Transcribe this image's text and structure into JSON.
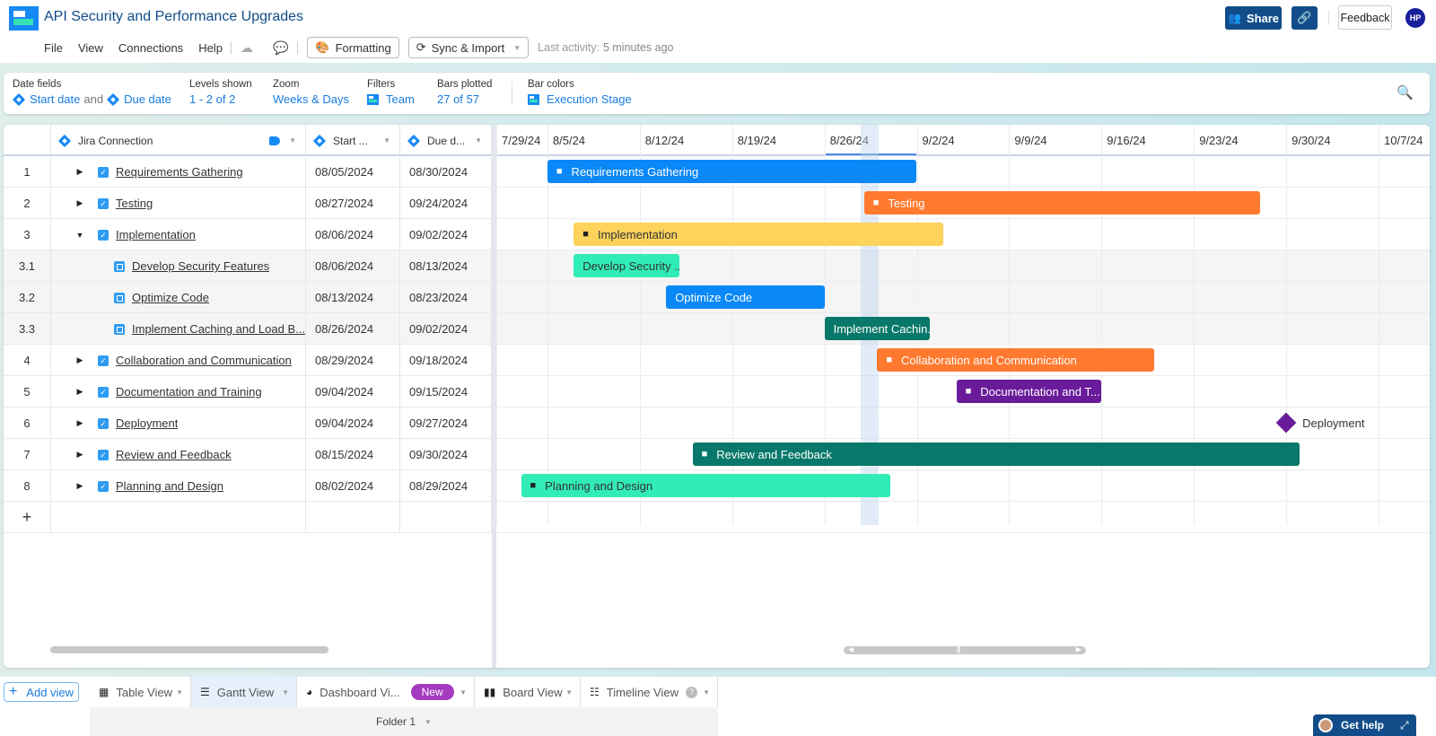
{
  "app": {
    "title": "API Security and Performance Upgrades",
    "menu": [
      "File",
      "View",
      "Connections",
      "Help"
    ],
    "formatting_label": "Formatting",
    "sync_label": "Sync & Import",
    "last_activity_label": "Last activity:",
    "last_activity_value": "5 minutes ago",
    "share_label": "Share",
    "feedback_label": "Feedback",
    "avatar_initials": "HP"
  },
  "settings": {
    "date_fields": {
      "label": "Date fields",
      "start": "Start date",
      "and": "and",
      "due": "Due date"
    },
    "levels": {
      "label": "Levels shown",
      "value": "1 - 2 of 2"
    },
    "zoom": {
      "label": "Zoom",
      "value": "Weeks & Days"
    },
    "filters": {
      "label": "Filters",
      "value": "Team"
    },
    "bars_plotted": {
      "label": "Bars plotted",
      "value": "27 of 57"
    },
    "bar_colors": {
      "label": "Bar colors",
      "value": "Execution Stage"
    }
  },
  "table": {
    "columns": {
      "name": "Jira Connection",
      "start": "Start ...",
      "due": "Due d..."
    },
    "rows": [
      {
        "num": "1",
        "name": "Requirements Gathering",
        "start": "08/05/2024",
        "due": "08/30/2024",
        "level": 1,
        "expanded": false
      },
      {
        "num": "2",
        "name": "Testing",
        "start": "08/27/2024",
        "due": "09/24/2024",
        "level": 1,
        "expanded": false
      },
      {
        "num": "3",
        "name": "Implementation",
        "start": "08/06/2024",
        "due": "09/02/2024",
        "level": 1,
        "expanded": true
      },
      {
        "num": "3.1",
        "name": "Develop Security Features",
        "start": "08/06/2024",
        "due": "08/13/2024",
        "level": 2
      },
      {
        "num": "3.2",
        "name": "Optimize Code",
        "start": "08/13/2024",
        "due": "08/23/2024",
        "level": 2
      },
      {
        "num": "3.3",
        "name": "Implement Caching and Load B...",
        "start": "08/26/2024",
        "due": "09/02/2024",
        "level": 2
      },
      {
        "num": "4",
        "name": "Collaboration and Communication",
        "start": "08/29/2024",
        "due": "09/18/2024",
        "level": 1,
        "expanded": false
      },
      {
        "num": "5",
        "name": "Documentation and Training",
        "start": "09/04/2024",
        "due": "09/15/2024",
        "level": 1,
        "expanded": false
      },
      {
        "num": "6",
        "name": "Deployment",
        "start": "09/04/2024",
        "due": "09/27/2024",
        "level": 1,
        "expanded": false
      },
      {
        "num": "7",
        "name": "Review and Feedback",
        "start": "08/15/2024",
        "due": "09/30/2024",
        "level": 1,
        "expanded": false
      },
      {
        "num": "8",
        "name": "Planning and Design",
        "start": "08/02/2024",
        "due": "08/29/2024",
        "level": 1,
        "expanded": false
      }
    ],
    "add_row_label": "+"
  },
  "chart_data": {
    "type": "gantt",
    "x_ticks": [
      "7/29/24",
      "8/5/24",
      "8/12/24",
      "8/19/24",
      "8/26/24",
      "9/2/24",
      "9/9/24",
      "9/16/24",
      "9/23/24",
      "9/30/24",
      "10/7/24"
    ],
    "x_range": [
      "2024-07-29",
      "2024-10-10"
    ],
    "today": "2024-08-29",
    "highlighted_tick": "8/26/24",
    "bars": [
      {
        "label": "Requirements Gathering",
        "start": "2024-08-05",
        "end": "2024-09-02",
        "color": "#0a88f7",
        "text_color": "#ffffff",
        "folder": true
      },
      {
        "label": "Testing",
        "start": "2024-08-29",
        "end": "2024-09-28",
        "color": "#ff7a2f",
        "text_color": "#ffffff",
        "folder": true
      },
      {
        "label": "Implementation",
        "start": "2024-08-07",
        "end": "2024-09-04",
        "color": "#fdd35c",
        "text_color": "#333333",
        "folder": true
      },
      {
        "label": "Develop Security ...",
        "start": "2024-08-07",
        "end": "2024-08-15",
        "color": "#32ecb7",
        "text_color": "#333333",
        "folder": false
      },
      {
        "label": "Optimize Code",
        "start": "2024-08-14",
        "end": "2024-08-26",
        "color": "#0a88f7",
        "text_color": "#ffffff",
        "folder": false
      },
      {
        "label": "Implement Cachin...",
        "start": "2024-08-26",
        "end": "2024-09-03",
        "color": "#077869",
        "text_color": "#ffffff",
        "folder": false
      },
      {
        "label": "Collaboration and Communication",
        "start": "2024-08-30",
        "end": "2024-09-20",
        "color": "#ff7a2f",
        "text_color": "#ffffff",
        "folder": true
      },
      {
        "label": "Documentation and T...",
        "start": "2024-09-05",
        "end": "2024-09-16",
        "color": "#6a1b9a",
        "text_color": "#ffffff",
        "folder": true
      },
      {
        "label": "Deployment",
        "milestone": "2024-09-30",
        "color": "#6a1b9a",
        "text_color": "#333333"
      },
      {
        "label": "Review and Feedback",
        "start": "2024-08-16",
        "end": "2024-10-01",
        "color": "#077869",
        "text_color": "#ffffff",
        "folder": true
      },
      {
        "label": "Planning and Design",
        "start": "2024-08-03",
        "end": "2024-08-31",
        "color": "#32ecb7",
        "text_color": "#333333",
        "folder": true
      }
    ]
  },
  "views": {
    "add_view_label": "Add view",
    "tabs": [
      {
        "label": "Table View",
        "icon": "table-icon"
      },
      {
        "label": "Gantt View",
        "icon": "gantt-icon",
        "active": true
      },
      {
        "label": "Dashboard Vi...",
        "icon": "pie-chart-icon",
        "badge": "New"
      },
      {
        "label": "Board View",
        "icon": "board-icon"
      },
      {
        "label": "Timeline View",
        "icon": "timeline-icon",
        "help": true
      }
    ],
    "folder_label": "Folder 1"
  },
  "help": {
    "label": "Get help"
  }
}
